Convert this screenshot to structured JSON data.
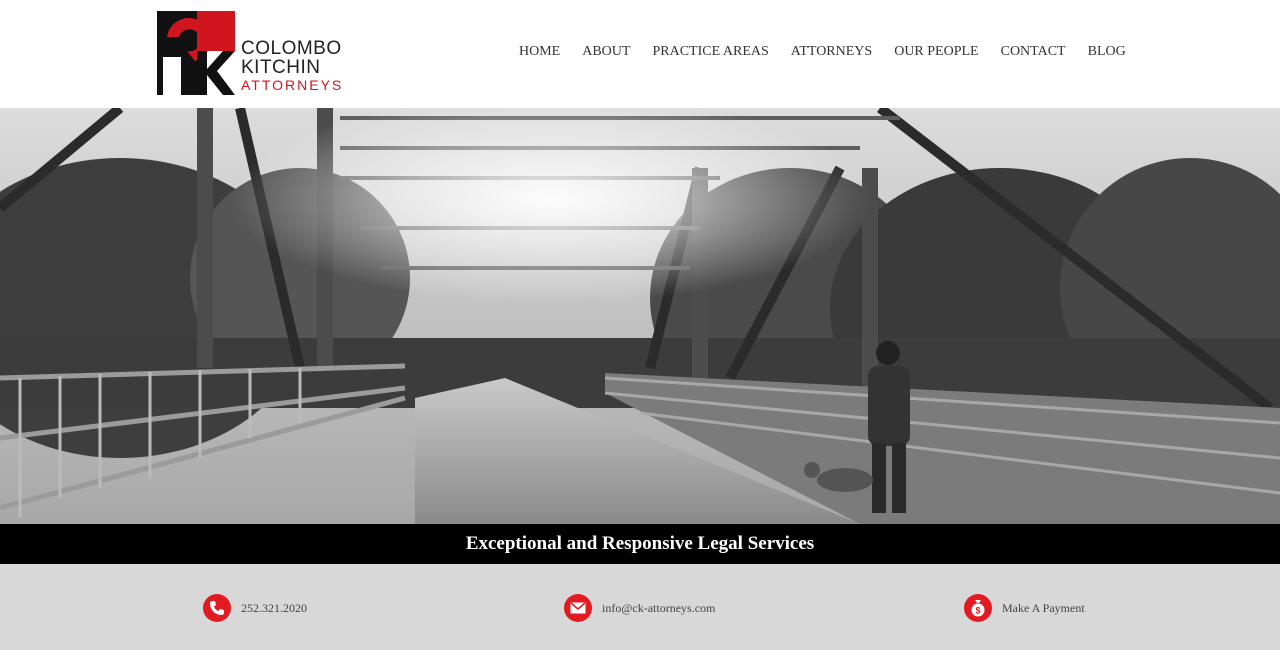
{
  "brand": {
    "logo_lines": [
      "COLOMBO",
      "KITCHIN",
      "ATTORNEYS"
    ],
    "logo_accent_color": "#d0151e"
  },
  "nav": {
    "items": [
      "HOME",
      "ABOUT",
      "PRACTICE AREAS",
      "ATTORNEYS",
      "OUR PEOPLE",
      "CONTACT",
      "BLOG"
    ]
  },
  "hero": {
    "tagline": "Exceptional and Responsive Legal Services"
  },
  "contact": {
    "phone": "252.321.2020",
    "email": "info@ck-attorneys.com",
    "payment": "Make A Payment",
    "icon_color": "#e21b23"
  }
}
